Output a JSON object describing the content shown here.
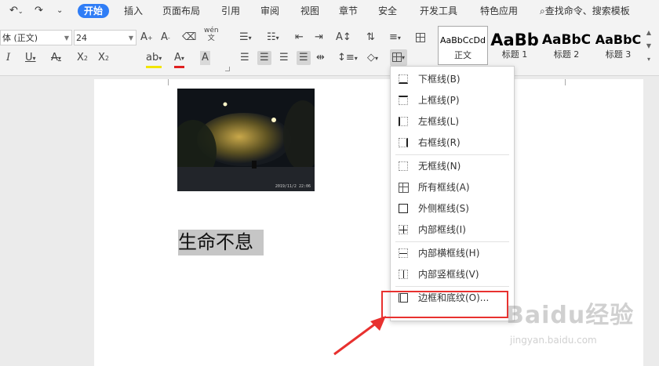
{
  "quick_access": {
    "undo_icon": "undo-icon",
    "redo_icon": "redo-icon"
  },
  "menubar": {
    "tabs": [
      "开始",
      "插入",
      "页面布局",
      "引用",
      "审阅",
      "视图",
      "章节",
      "安全",
      "开发工具",
      "特色应用"
    ],
    "search_label": "查找命令、搜索模板"
  },
  "toolbar": {
    "font_name": "体 (正文)",
    "font_size": "24",
    "pinyin_label": "wén",
    "style_presets": [
      {
        "preview": "AaBbCcDd",
        "name": "正文"
      },
      {
        "preview": "AaBb",
        "name": "标题 1"
      },
      {
        "preview": "AaBbC",
        "name": "标题 2"
      },
      {
        "preview": "AaBbC",
        "name": "标题 3"
      }
    ]
  },
  "document": {
    "photo_timestamp": "2019/11/2 22:06",
    "body_text": "生命不息"
  },
  "border_menu": {
    "items": [
      {
        "label": "下框线(B)",
        "icon": "bottom-border-icon"
      },
      {
        "label": "上框线(P)",
        "icon": "top-border-icon"
      },
      {
        "label": "左框线(L)",
        "icon": "left-border-icon"
      },
      {
        "label": "右框线(R)",
        "icon": "right-border-icon"
      },
      {
        "label": "无框线(N)",
        "icon": "no-border-icon"
      },
      {
        "label": "所有框线(A)",
        "icon": "all-borders-icon"
      },
      {
        "label": "外侧框线(S)",
        "icon": "outside-borders-icon"
      },
      {
        "label": "内部框线(I)",
        "icon": "inside-borders-icon"
      },
      {
        "label": "内部横框线(H)",
        "icon": "inside-horizontal-border-icon"
      },
      {
        "label": "内部竖框线(V)",
        "icon": "inside-vertical-border-icon"
      },
      {
        "label": "边框和底纹(O)...",
        "icon": "borders-shading-icon"
      }
    ]
  },
  "watermark": {
    "brand": "Baidu经验",
    "site": "jingyan.baidu.com"
  },
  "colors": {
    "accent": "#2f7df6",
    "highlight_box": "#e8312f",
    "text_highlight": "#c6c6c6"
  }
}
